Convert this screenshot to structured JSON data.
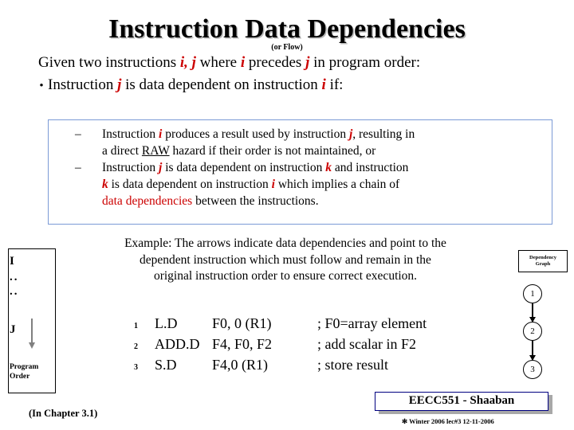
{
  "title": "Instruction Data Dependencies",
  "subtitle": "(or Flow)",
  "intro": {
    "given_pre": "Given two instructions ",
    "given_ij": "i, j",
    "given_mid": " where ",
    "given_i": "i",
    "given_precedes": " precedes ",
    "given_j": "j",
    "given_post": " in program order:",
    "bullet_dot": "•",
    "bullet_pre": "Instruction ",
    "bullet_j": "j",
    "bullet_mid": " is data dependent on instruction ",
    "bullet_i": "i",
    "bullet_post": " if:"
  },
  "box": {
    "dash": "–",
    "item1_a": "Instruction ",
    "item1_i": "i",
    "item1_b": " produces a result used by instruction ",
    "item1_j": "j",
    "item1_c": ", resulting in",
    "item1_line2_a": "a direct ",
    "item1_raw": "RAW",
    "item1_line2_b": " hazard if their order is not maintained, or",
    "item2_a": "Instruction ",
    "item2_j": "j",
    "item2_b": " is data dependent on instruction ",
    "item2_k": "k",
    "item2_c": " and instruction",
    "item2_line2_k": "k",
    "item2_line2_a": " is data dependent on instruction ",
    "item2_line2_i": "i",
    "item2_line2_b": "  which implies  a chain of",
    "item2_line3_red": "data dependencies",
    "item2_line3_b": " between the instructions."
  },
  "example": {
    "line1": "Example:  The arrows indicate data dependencies and point to the",
    "line2": "dependent instruction which must follow and remain in the",
    "line3": "original instruction order to ensure correct execution."
  },
  "program_order": {
    "i_label": "I",
    "dots1": "..",
    "dots2": "..",
    "j_label": "J",
    "caption_line1": "Program",
    "caption_line2": "Order"
  },
  "dependency_graph": {
    "caption_line1": "Dependency",
    "caption_line2": "Graph",
    "nodes": [
      "1",
      "2",
      "3"
    ]
  },
  "code": {
    "rows": [
      {
        "num": "1",
        "instr": "L.D",
        "operands": "F0, 0 (R1)",
        "comment": "; F0=array element"
      },
      {
        "num": "2",
        "instr": "ADD.D",
        "operands": "F4, F0, F2",
        "comment": "; add scalar in F2"
      },
      {
        "num": "3",
        "instr": "S.D",
        "operands": "F4,0 (R1)",
        "comment": "; store result"
      }
    ]
  },
  "footer": {
    "chapter": "(In  Chapter 3.1)",
    "course": "EECC551 - Shaaban",
    "note": "✻ Winter 2006  lec#3   12-11-2006"
  }
}
